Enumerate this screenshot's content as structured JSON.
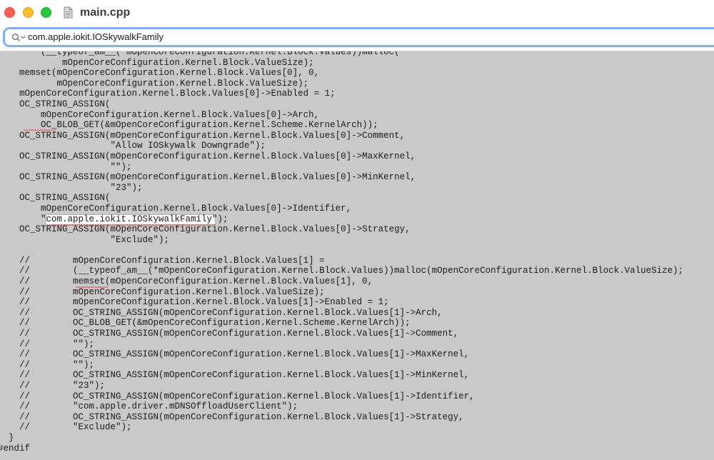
{
  "window": {
    "title": "main.cpp"
  },
  "find": {
    "value": "com.apple.iokit.IOSkywalkFamily"
  },
  "icons": {
    "document": "document-icon",
    "find": "magnifier-dropdown-icon"
  },
  "colors": {
    "editor_bg": "#c9c9c9",
    "find_focus_ring": "#80b0f2",
    "spell_squiggle": "#e0392f",
    "close": "#ff5f57",
    "minimize": "#febc2e",
    "maximize": "#28c840"
  },
  "code_lines": [
    "        (__typeof_am__(*mOpenCoreConfiguration.Kernel.Block.Values))malloc(",
    "            mOpenCoreConfiguration.Kernel.Block.ValueSize);",
    "    memset(mOpenCoreConfiguration.Kernel.Block.Values[0], 0,",
    "           mOpenCoreConfiguration.Kernel.Block.ValueSize);",
    "    mOpenCoreConfiguration.Kernel.Block.Values[0]->Enabled = 1;",
    "    OC_STRING_ASSIGN(",
    "        mOpenCoreConfiguration.Kernel.Block.Values[0]->Arch,",
    "        OC_BLOB_GET(&mOpenCoreConfiguration.Kernel.Scheme.KernelArch));",
    "    OC_STRING_ASSIGN(mOpenCoreConfiguration.Kernel.Block.Values[0]->Comment,",
    "                     \"Allow IOSkywalk Downgrade\");",
    "    OC_STRING_ASSIGN(mOpenCoreConfiguration.Kernel.Block.Values[0]->MaxKernel,",
    "                     \"\");",
    "    OC_STRING_ASSIGN(mOpenCoreConfiguration.Kernel.Block.Values[0]->MinKernel,",
    "                     \"23\");",
    "    OC_STRING_ASSIGN(",
    "        mOpenCoreConfiguration.Kernel.Block.Values[0]->Identifier,",
    "        \"com.apple.iokit.IOSkywalkFamily\");",
    "    OC_STRING_ASSIGN(mOpenCoreConfiguration.Kernel.Block.Values[0]->Strategy,",
    "                     \"Exclude\");",
    "",
    "    //        mOpenCoreConfiguration.Kernel.Block.Values[1] =",
    "    //        (__typeof_am__(*mOpenCoreConfiguration.Kernel.Block.Values))malloc(mOpenCoreConfiguration.Kernel.Block.ValueSize);",
    "    //        memset(mOpenCoreConfiguration.Kernel.Block.Values[1], 0,",
    "    //        mOpenCoreConfiguration.Kernel.Block.ValueSize);",
    "    //        mOpenCoreConfiguration.Kernel.Block.Values[1]->Enabled = 1;",
    "    //        OC_STRING_ASSIGN(mOpenCoreConfiguration.Kernel.Block.Values[1]->Arch,",
    "    //        OC_BLOB_GET(&mOpenCoreConfiguration.Kernel.Scheme.KernelArch));",
    "    //        OC_STRING_ASSIGN(mOpenCoreConfiguration.Kernel.Block.Values[1]->Comment,",
    "    //        \"\");",
    "    //        OC_STRING_ASSIGN(mOpenCoreConfiguration.Kernel.Block.Values[1]->MaxKernel,",
    "    //        \"\");",
    "    //        OC_STRING_ASSIGN(mOpenCoreConfiguration.Kernel.Block.Values[1]->MinKernel,",
    "    //        \"23\");",
    "    //        OC_STRING_ASSIGN(mOpenCoreConfiguration.Kernel.Block.Values[1]->Identifier,",
    "    //        \"com.apple.driver.mDNSOffloadUserClient\");",
    "    //        OC_STRING_ASSIGN(mOpenCoreConfiguration.Kernel.Block.Values[1]->Strategy,",
    "    //        \"Exclude\");",
    "  }",
    "#endif"
  ]
}
